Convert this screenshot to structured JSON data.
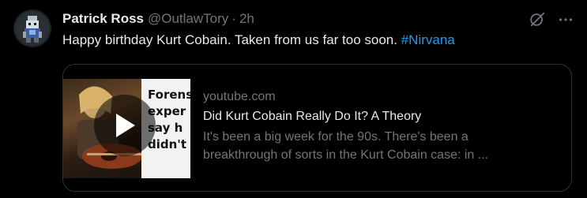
{
  "tweet": {
    "display_name": "Patrick Ross",
    "handle": "@OutlawTory",
    "separator": "·",
    "time": "2h",
    "text": "Happy birthday Kurt Cobain. Taken from us far too soon.",
    "hashtag": "#Nirvana"
  },
  "card": {
    "domain": "youtube.com",
    "title": "Did Kurt Cobain Really Do It? A Theory",
    "description_line1": "It's been a big week for the 90s. There's been a",
    "description_line2": "breakthrough of sorts in the Kurt Cobain case: in ...",
    "thumbnail_text": "Forens\nexper\nsay h\ndidn't d"
  },
  "icons": {
    "grok": "grok-icon",
    "more": "more-icon",
    "play": "play-icon",
    "avatar": "avatar-image"
  },
  "colors": {
    "background": "#000000",
    "text": "#e7e9ea",
    "secondary": "#71767b",
    "link": "#1d9bf0",
    "border": "#2f3336"
  }
}
